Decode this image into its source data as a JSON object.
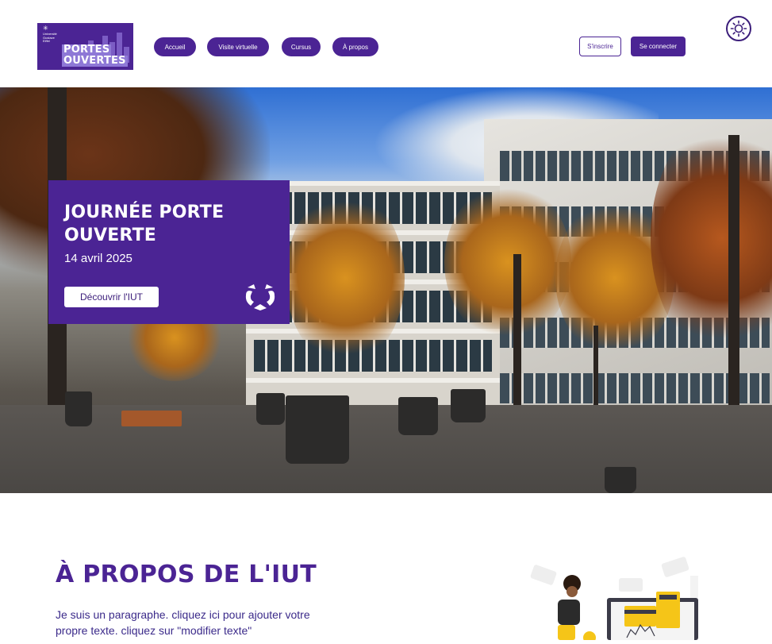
{
  "header": {
    "logo": {
      "univ_text": "Université Gustave Eiffel",
      "line1": "PORTES",
      "line2": "OUVERTES"
    },
    "nav": [
      {
        "label": "Accueil"
      },
      {
        "label": "Visite virtuelle"
      },
      {
        "label": "Cursus"
      },
      {
        "label": "À propos"
      }
    ],
    "signup_label": "S'inscrire",
    "login_label": "Se connecter",
    "theme_icon": "sun-icon"
  },
  "hero": {
    "title": "JOURNÉE PORTE OUVERTE",
    "date": "14 avril 2025",
    "cta_label": "Découvrir l'IUT",
    "emblem_icon": "university-emblem-icon"
  },
  "about": {
    "title": "À PROPOS DE L'IUT",
    "text": "Je suis un paragraphe. cliquez ici pour ajouter votre propre texte. cliquez sur \"modifier texte\""
  },
  "colors": {
    "brand": "#4b2494",
    "brand_light": "#8e78d6",
    "text_dark": "#3b2a8a",
    "background": "#ffffff"
  }
}
